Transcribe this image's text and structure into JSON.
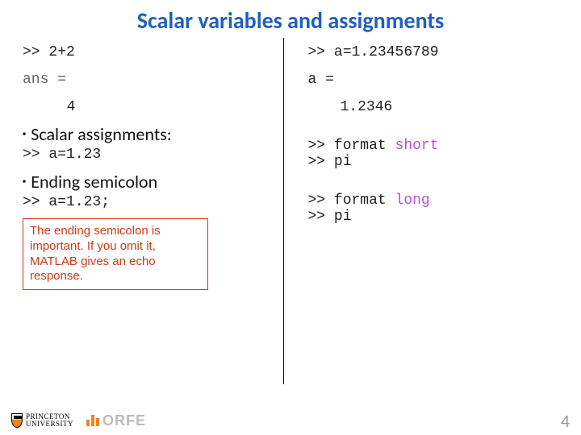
{
  "title": "Scalar variables and assignments",
  "left": {
    "expr1_prompt": ">> ",
    "expr1_code": "2+2",
    "expr1_ansLabel": "ans =",
    "expr1_result": "4",
    "bullet1": "Scalar assignments:",
    "assign1_prompt": ">> ",
    "assign1_code": "a=1.23",
    "bullet2": "Ending semicolon",
    "assign2_prompt": ">> ",
    "assign2_code": "a=1.23;",
    "callout": "The ending semicolon is important. If you omit it, MATLAB gives an echo response."
  },
  "right": {
    "assign_prompt": ">> ",
    "assign_code": "a=1.23456789",
    "assign_echoLabel": "a =",
    "assign_echoValue": "1.2346",
    "fmt_short_prefix": ">> format ",
    "fmt_short_kw": "short",
    "pi1_prompt": ">> ",
    "pi1_code": "pi",
    "fmt_long_prefix": ">> format ",
    "fmt_long_kw": "long",
    "pi2_prompt": ">> ",
    "pi2_code": "pi"
  },
  "footer": {
    "princeton_top": "PRINCETON",
    "princeton_bot": "UNIVERSITY",
    "orfe": "ORFE",
    "page": "4"
  }
}
